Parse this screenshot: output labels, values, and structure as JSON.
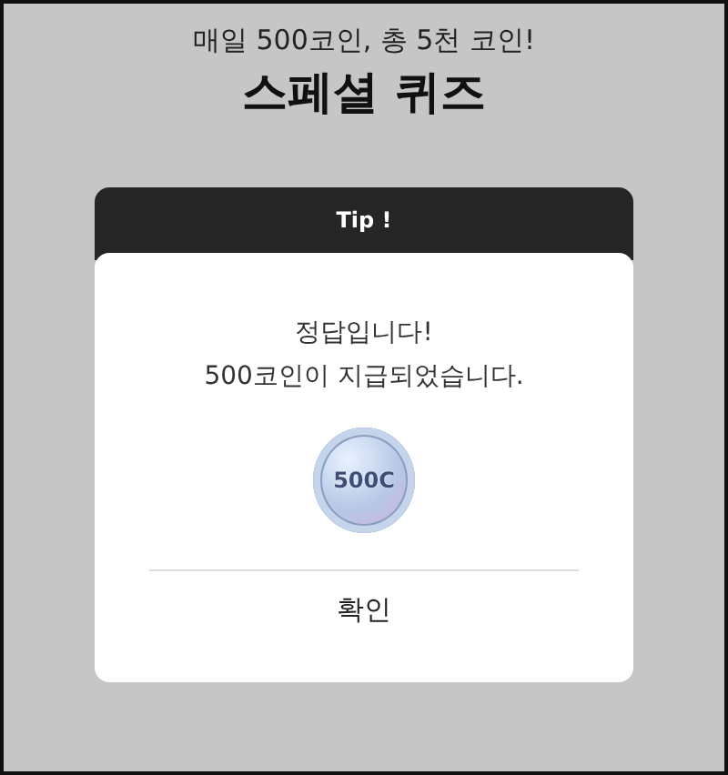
{
  "header": {
    "subtitle": "매일 500코인, 총 5천 코인!",
    "title": "스페셜 퀴즈"
  },
  "dialog": {
    "tab_title": "Tip !",
    "message_lines": [
      "정답입니다!",
      "500코인이 지급되었습니다."
    ],
    "coin": {
      "label": "500C"
    },
    "confirm_button": "확인"
  }
}
